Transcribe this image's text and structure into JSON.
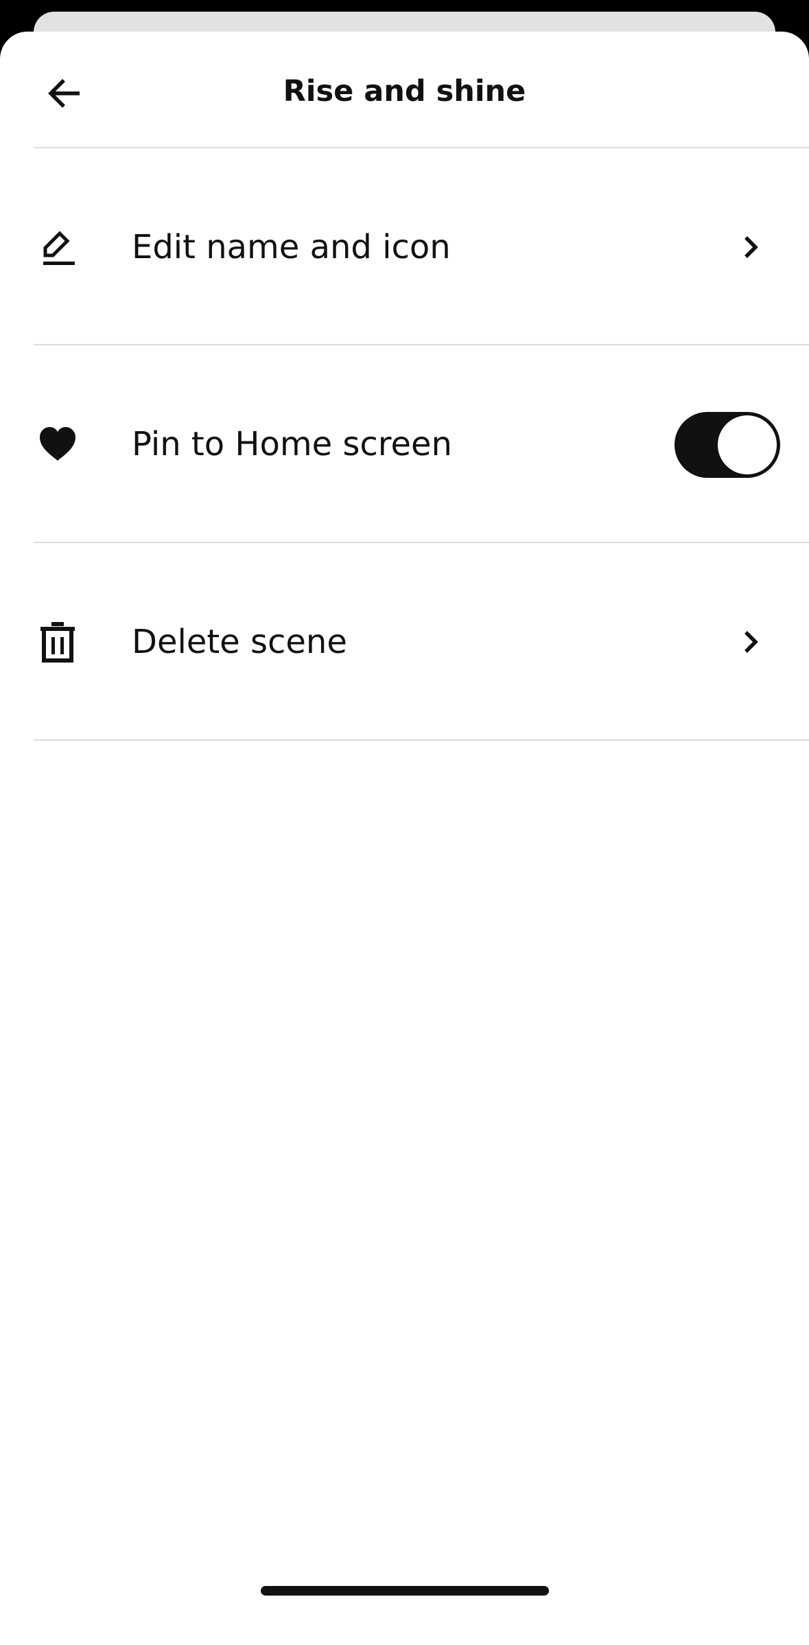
{
  "header": {
    "title": "Rise and shine",
    "back_icon": "arrow-left-icon"
  },
  "settings": {
    "items": [
      {
        "label": "Edit name and icon",
        "icon": "pencil-edit-icon",
        "accessory": "chevron-right-icon"
      },
      {
        "label": "Pin to Home screen",
        "icon": "heart-icon",
        "accessory": "toggle",
        "toggle_on": true
      },
      {
        "label": "Delete scene",
        "icon": "trash-icon",
        "accessory": "chevron-right-icon"
      }
    ]
  },
  "colors": {
    "text": "#111111",
    "divider": "#dcdcdc",
    "toggle_on": "#111111",
    "background": "#ffffff"
  }
}
